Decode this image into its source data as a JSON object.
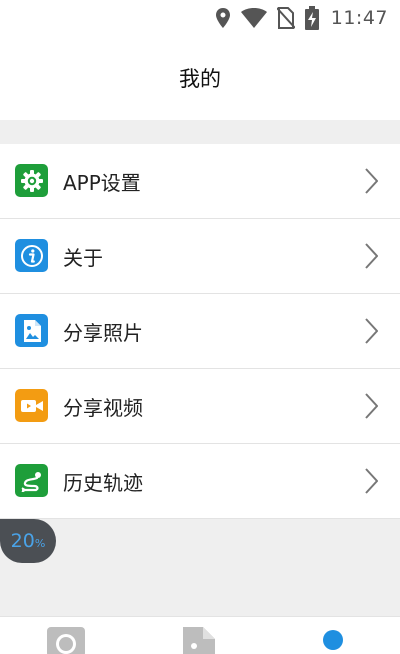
{
  "status": {
    "time": "11:47",
    "icons": [
      "location-icon",
      "wifi-icon",
      "no-sim-icon",
      "battery-charging-icon"
    ]
  },
  "header": {
    "title": "我的"
  },
  "menu": {
    "items": [
      {
        "label": "APP设置",
        "icon": "gear-icon",
        "color": "#1e9e3a"
      },
      {
        "label": "关于",
        "icon": "info-icon",
        "color": "#1f8fe0"
      },
      {
        "label": "分享照片",
        "icon": "photo-file-icon",
        "color": "#1f8fe0"
      },
      {
        "label": "分享视频",
        "icon": "video-camera-icon",
        "color": "#f39c12"
      },
      {
        "label": "历史轨迹",
        "icon": "route-icon",
        "color": "#1e9e3a"
      }
    ]
  },
  "overlay": {
    "value": "20",
    "unit": "%"
  },
  "tabbar": {
    "tabs": [
      {
        "icon": "camera-icon"
      },
      {
        "icon": "file-icon"
      },
      {
        "icon": "profile-dot-icon",
        "active": true
      }
    ],
    "active_color": "#1f8fe0"
  }
}
